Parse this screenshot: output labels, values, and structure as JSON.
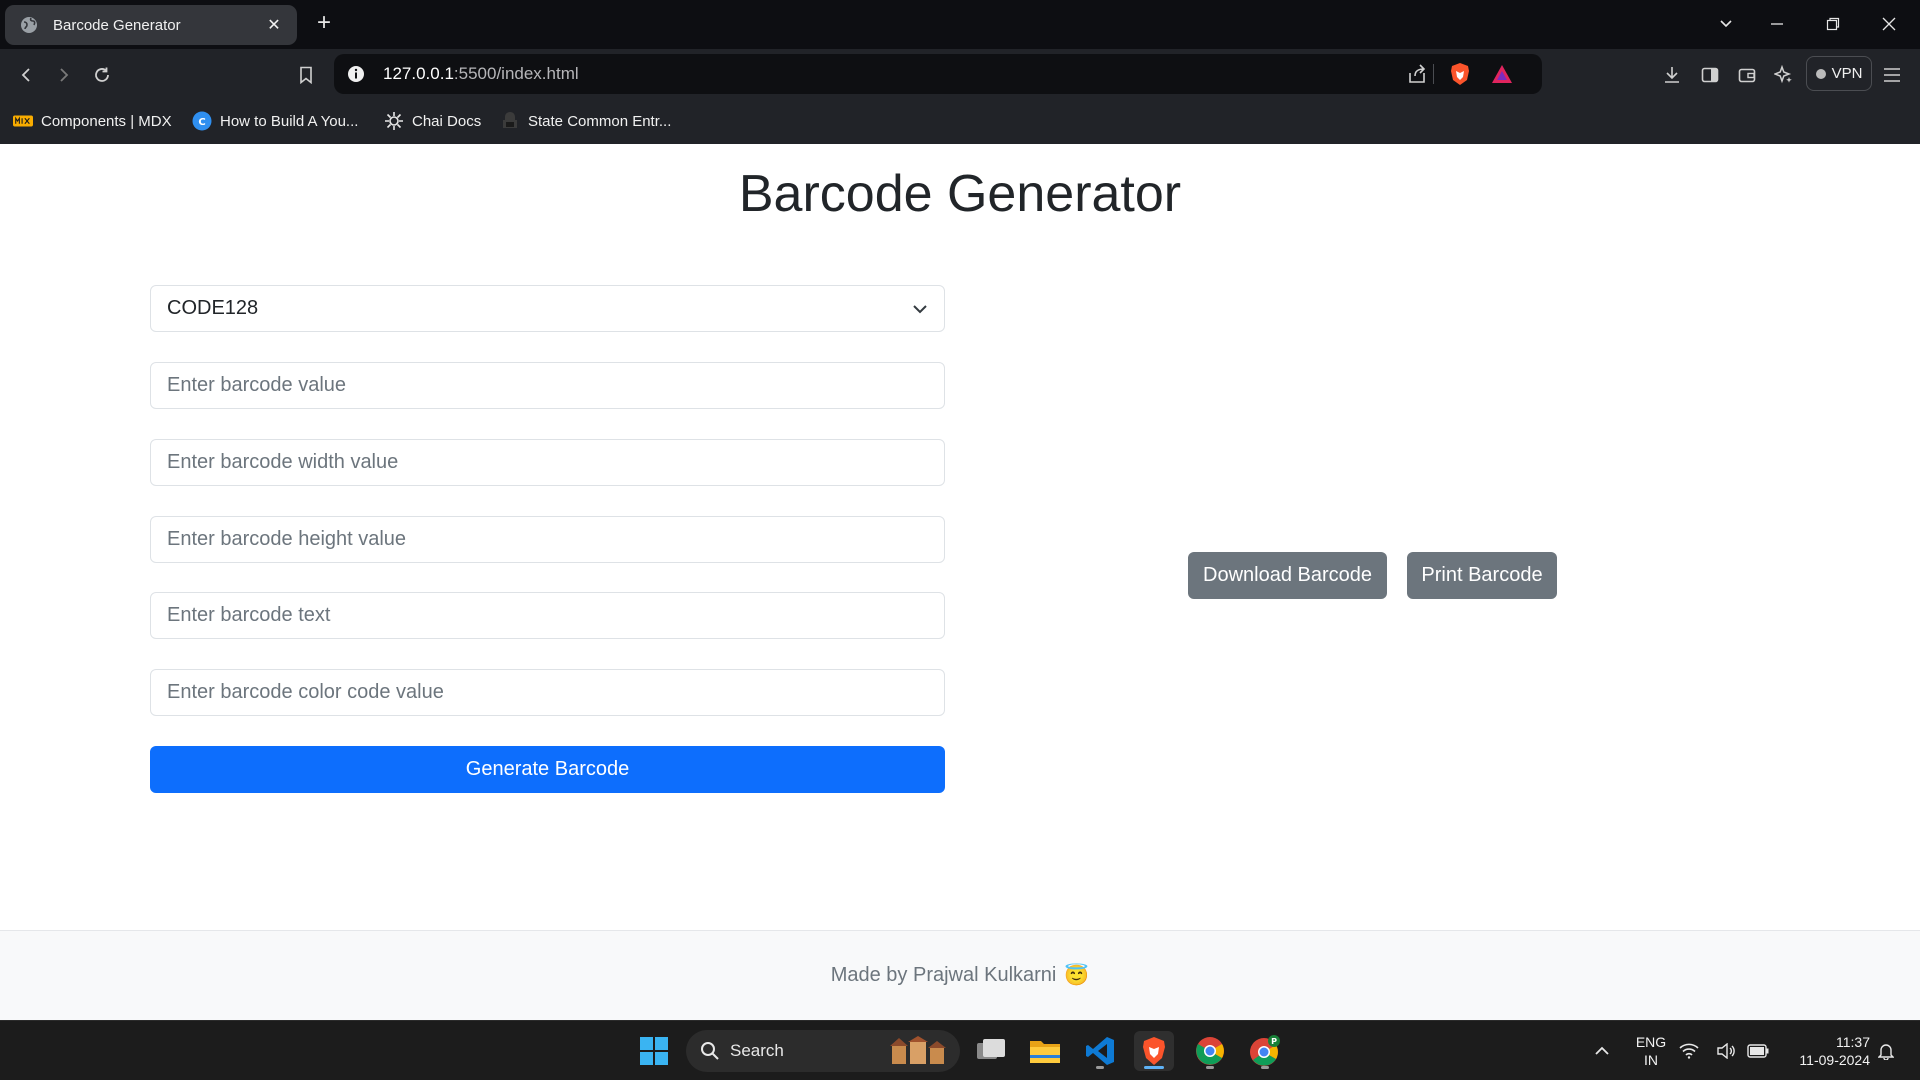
{
  "browser": {
    "tab": {
      "title": "Barcode Generator",
      "close": "✕"
    },
    "new_tab": "+",
    "url": {
      "host": "127.0.0.1",
      "rest": ":5500/index.html"
    },
    "vpn_label": "VPN",
    "bookmarks": [
      {
        "label": "Components | MDX"
      },
      {
        "label": "How to Build A You..."
      },
      {
        "label": "Chai Docs"
      },
      {
        "label": "State Common Entr..."
      }
    ]
  },
  "page": {
    "title": "Barcode Generator",
    "format_select": {
      "value": "CODE128"
    },
    "inputs": {
      "value_placeholder": "Enter barcode value",
      "width_placeholder": "Enter barcode width value",
      "height_placeholder": "Enter barcode height value",
      "text_placeholder": "Enter barcode text",
      "color_placeholder": "Enter barcode color code value"
    },
    "generate_label": "Generate Barcode",
    "download_label": "Download Barcode",
    "print_label": "Print Barcode",
    "footer_text": "Made by Prajwal Kulkarni",
    "footer_emoji": "😇"
  },
  "taskbar": {
    "search_label": "Search",
    "lang": [
      "ENG",
      "IN"
    ],
    "time": "11:37",
    "date": "11-09-2024"
  },
  "colors": {
    "primary": "#0d6efd",
    "secondary": "#6c757d",
    "brave": "#fb542b"
  }
}
